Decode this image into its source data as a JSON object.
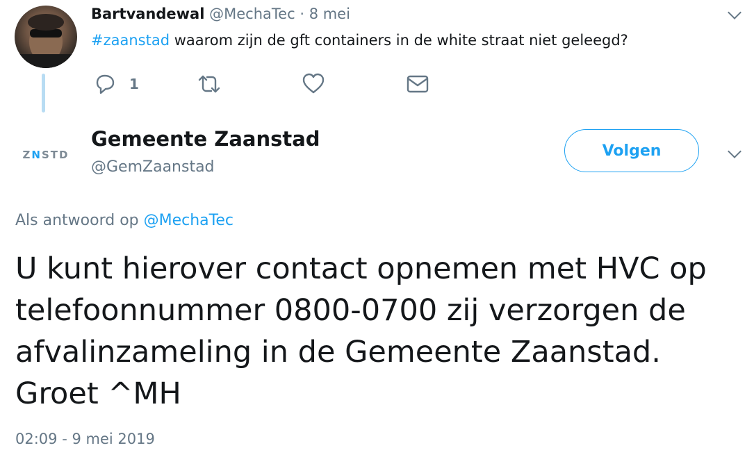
{
  "parent_tweet": {
    "author_name": "Bartvandewal",
    "handle": "@MechaTec",
    "separator": "·",
    "date": "8 mei",
    "hashtag": "#zaanstad",
    "text": " waarom zijn de gft containers in de white straat niet geleegd?",
    "reply_count": "1",
    "icons": [
      "reply-icon",
      "retweet-icon",
      "like-icon",
      "message-icon",
      "chevron-down-icon"
    ]
  },
  "reply_tweet": {
    "author_name": "Gemeente Zaanstad",
    "handle": "@GemZaanstad",
    "avatar_logo": {
      "prefix": "Z",
      "accent": "N",
      "suffix": "STD"
    },
    "follow_label": "Volgen",
    "reply_to_prefix": "Als antwoord op ",
    "reply_to_mention": "@MechaTec",
    "text": "U kunt hierover contact opnemen met HVC op telefoonnummer 0800-0700 zij verzorgen de afvalinzameling in de Gemeente Zaanstad. Groet ^MH",
    "timestamp": "02:09 - 9 mei 2019"
  },
  "colors": {
    "accent": "#1da1f2",
    "muted": "#657786",
    "text": "#14171a",
    "thread_line": "#b8dcf3"
  }
}
